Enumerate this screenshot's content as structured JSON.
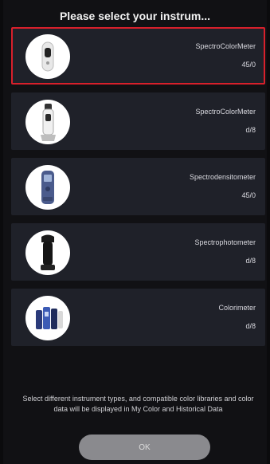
{
  "header": {
    "title": "Please select your instrum..."
  },
  "instruments": [
    {
      "name": "SpectroColorMeter",
      "geometry": "45/0",
      "selected": true,
      "icon": "handheld-colorimeter-white-icon"
    },
    {
      "name": "SpectroColorMeter",
      "geometry": "d/8",
      "selected": false,
      "icon": "pen-colorimeter-icon"
    },
    {
      "name": "Spectrodensitometer",
      "geometry": "45/0",
      "selected": false,
      "icon": "blue-densitometer-icon"
    },
    {
      "name": "Spectrophotometer",
      "geometry": "d/8",
      "selected": false,
      "icon": "black-spectrophotometer-icon"
    },
    {
      "name": "Colorimeter",
      "geometry": "d/8",
      "selected": false,
      "icon": "colorimeter-group-icon"
    }
  ],
  "footer": {
    "hint": "Select different instrument types, and compatible color libraries and color data will be displayed in My Color and Historical Data",
    "ok_label": "OK"
  },
  "colors": {
    "selected_border": "#d8202b",
    "card_bg": "#1f2129",
    "ok_bg": "#8a8a8e"
  }
}
